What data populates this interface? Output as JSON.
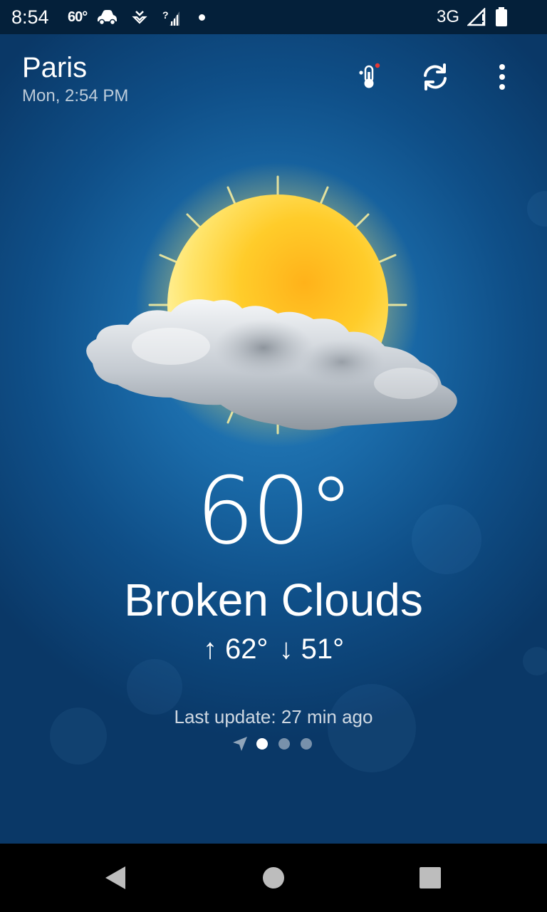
{
  "status_bar": {
    "time": "8:54",
    "temp": "60°",
    "network": "3G"
  },
  "header": {
    "city": "Paris",
    "datetime": "Mon, 2:54 PM"
  },
  "toolbar": {
    "icons": [
      "thermometer-icon",
      "refresh-icon",
      "more-vert-icon"
    ]
  },
  "weather": {
    "temperature": "60°",
    "condition": "Broken Clouds",
    "high": "↑ 62°",
    "low": "↓ 51°",
    "last_update": "Last update: 27 min ago",
    "icon": "sun-behind-cloud"
  },
  "pager": {
    "pages": 3,
    "active_index": 0
  },
  "colors": {
    "background": "#1a6aa8",
    "status_bar": "#04203a",
    "alert_dot": "#e53935"
  }
}
